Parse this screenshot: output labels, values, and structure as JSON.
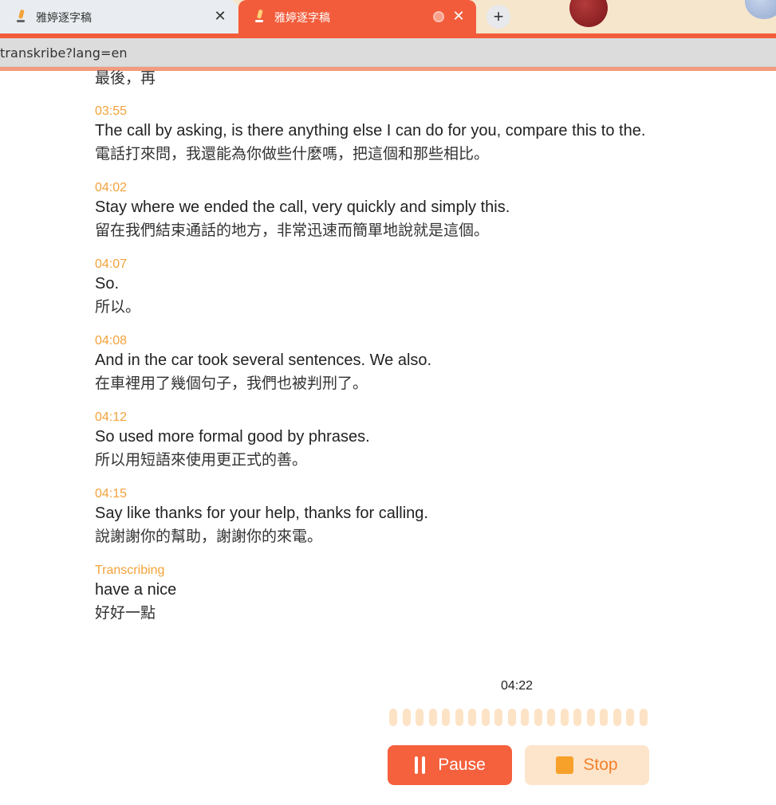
{
  "browser": {
    "tabs": [
      {
        "title": "雅婷逐字稿",
        "active": false
      },
      {
        "title": "雅婷逐字稿",
        "active": true
      }
    ],
    "url": "transkribe?lang=en",
    "new_tab": "+",
    "close": "✕"
  },
  "transcript": {
    "top_partial_translation": "最後，再",
    "entries": [
      {
        "time": "03:55",
        "text": "The call by asking, is there anything else I can do for you, compare this to the.",
        "translation": "電話打來問，我還能為你做些什麼嗎，把這個和那些相比。"
      },
      {
        "time": "04:02",
        "text": "Stay where we ended the call, very quickly and simply this.",
        "translation": "留在我們結束通話的地方，非常迅速而簡單地說就是這個。"
      },
      {
        "time": "04:07",
        "text": "So.",
        "translation": "所以。"
      },
      {
        "time": "04:08",
        "text": "And in the car took several sentences. We also.",
        "translation": "在車裡用了幾個句子，我們也被判刑了。"
      },
      {
        "time": "04:12",
        "text": "So used more formal good by phrases.",
        "translation": "所以用短語來使用更正式的善。"
      },
      {
        "time": "04:15",
        "text": "Say like thanks for your help, thanks for calling.",
        "translation": "說謝謝你的幫助，謝謝你的來電。"
      }
    ],
    "live": {
      "status": "Transcribing",
      "text": "have a nice",
      "translation": "好好一點"
    }
  },
  "recorder": {
    "elapsed": "04:22",
    "pause_label": "Pause",
    "stop_label": "Stop"
  },
  "colors": {
    "accent": "#f25c3b",
    "timestamp": "#f3a23a",
    "stop_bg": "#fde5cb"
  }
}
